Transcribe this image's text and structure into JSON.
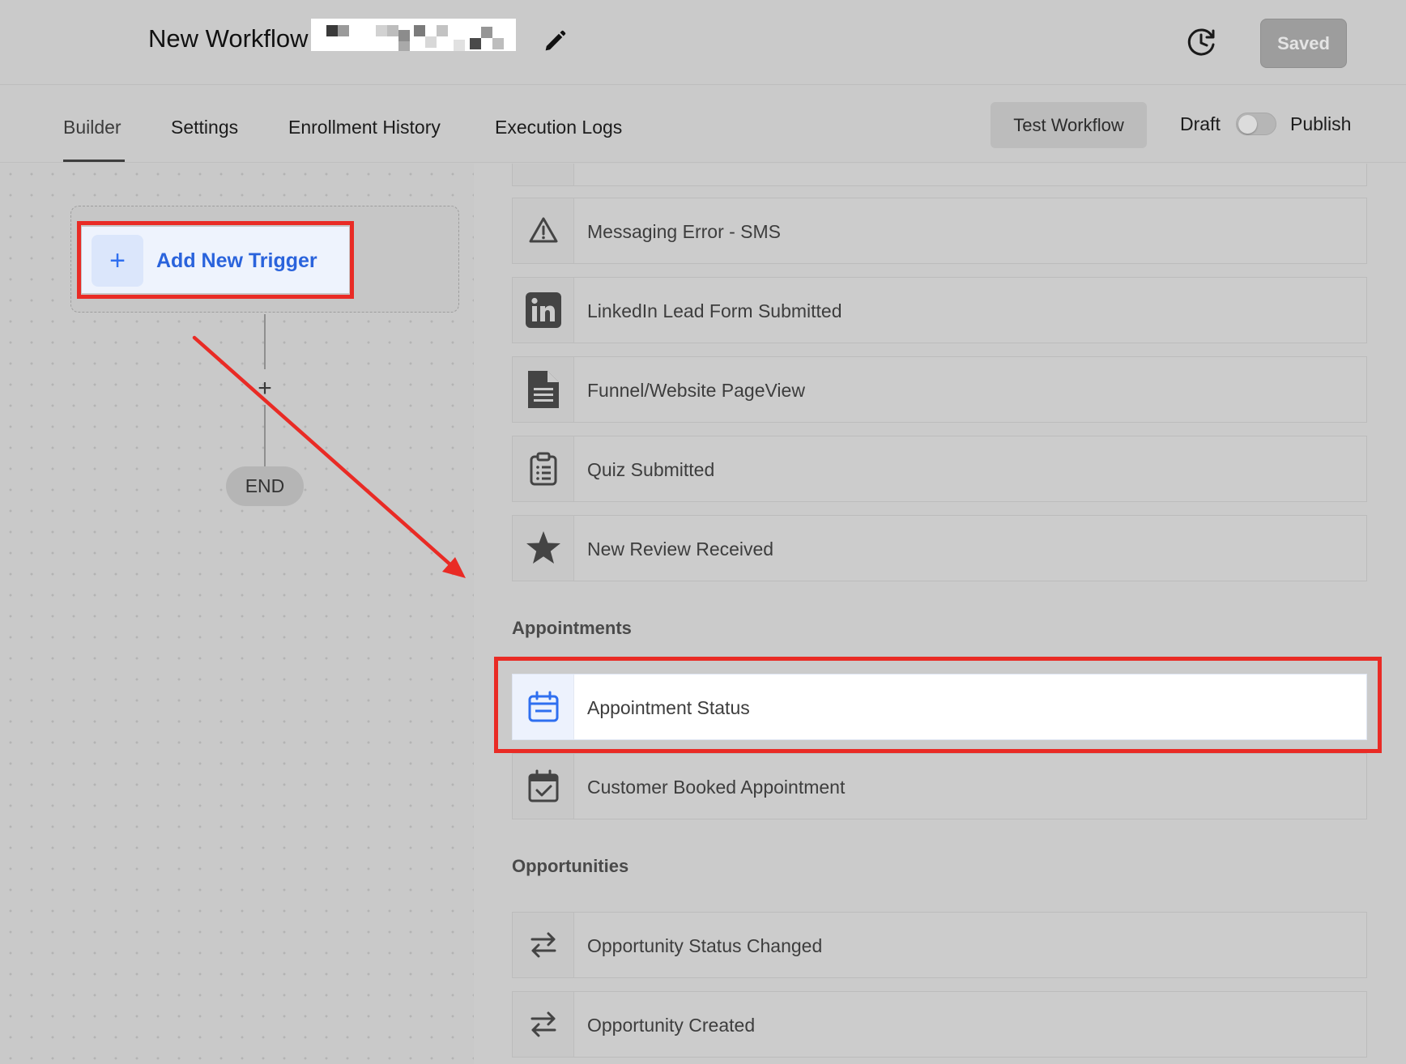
{
  "header": {
    "workflow_title": "New Workflow",
    "saved_label": "Saved"
  },
  "tabs": [
    {
      "label": "Builder",
      "active": true
    },
    {
      "label": "Settings"
    },
    {
      "label": "Enrollment History"
    },
    {
      "label": "Execution Logs"
    }
  ],
  "toolbar": {
    "test_label": "Test Workflow",
    "draft_label": "Draft",
    "publish_label": "Publish",
    "publish_toggle_on": false
  },
  "canvas": {
    "add_trigger_label": "Add New Trigger",
    "end_label": "END"
  },
  "trigger_list": {
    "items_top": [
      {
        "label": "Messaging Error - SMS",
        "icon": "warning-triangle-icon"
      },
      {
        "label": "LinkedIn Lead Form Submitted",
        "icon": "linkedin-icon"
      },
      {
        "label": "Funnel/Website PageView",
        "icon": "document-icon"
      },
      {
        "label": "Quiz Submitted",
        "icon": "clipboard-list-icon"
      },
      {
        "label": "New Review Received",
        "icon": "star-icon"
      }
    ],
    "appointments": {
      "title": "Appointments",
      "items": [
        {
          "label": "Appointment Status",
          "icon": "calendar-icon",
          "selected": true
        },
        {
          "label": "Customer Booked Appointment",
          "icon": "calendar-check-icon"
        }
      ]
    },
    "opportunities": {
      "title": "Opportunities",
      "items": [
        {
          "label": "Opportunity Status Changed",
          "icon": "swap-arrows-icon"
        },
        {
          "label": "Opportunity Created",
          "icon": "swap-arrows-icon"
        }
      ]
    }
  },
  "colors": {
    "annotation_red": "#e92b25",
    "accent_blue": "#2a63dc"
  }
}
